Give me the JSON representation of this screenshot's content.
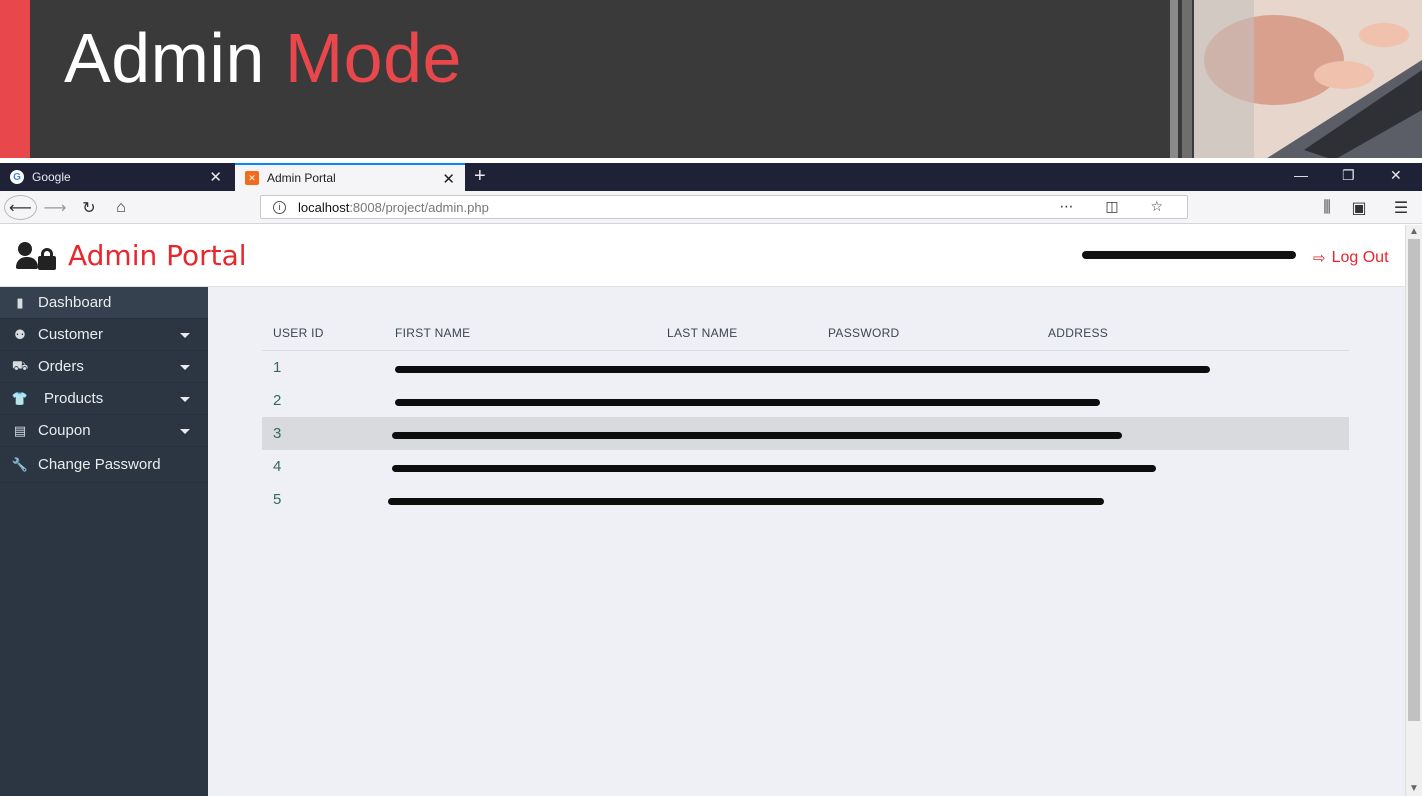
{
  "slide": {
    "title_main": "Admin",
    "title_accent": "Mode"
  },
  "browser": {
    "tabs": [
      {
        "label": "Google",
        "active": false
      },
      {
        "label": "Admin Portal",
        "active": true
      }
    ],
    "url_host": "localhost",
    "url_path": ":8008/project/admin.php"
  },
  "header": {
    "brand": "Admin Portal",
    "logout_label": "Log Out"
  },
  "sidebar": {
    "items": [
      {
        "label": "Dashboard",
        "icon": "clipboard-icon",
        "dropdown": false
      },
      {
        "label": "Customer",
        "icon": "users-icon",
        "dropdown": true
      },
      {
        "label": "Orders",
        "icon": "truck-icon",
        "dropdown": true
      },
      {
        "label": "Products",
        "icon": "shirt-icon",
        "dropdown": true
      },
      {
        "label": "Coupon",
        "icon": "ticket-icon",
        "dropdown": true
      },
      {
        "label": "Change Password",
        "icon": "wrench-icon",
        "dropdown": false
      }
    ]
  },
  "table": {
    "columns": [
      "USER ID",
      "FIRST NAME",
      "LAST NAME",
      "PASSWORD",
      "ADDRESS"
    ],
    "rows": [
      {
        "id": "1"
      },
      {
        "id": "2"
      },
      {
        "id": "3"
      },
      {
        "id": "4"
      },
      {
        "id": "5"
      }
    ]
  },
  "colors": {
    "accent": "#e8262b",
    "sidebar_bg": "#2c3542",
    "page_bg": "#eef0f5",
    "row_text": "#356a5c"
  }
}
